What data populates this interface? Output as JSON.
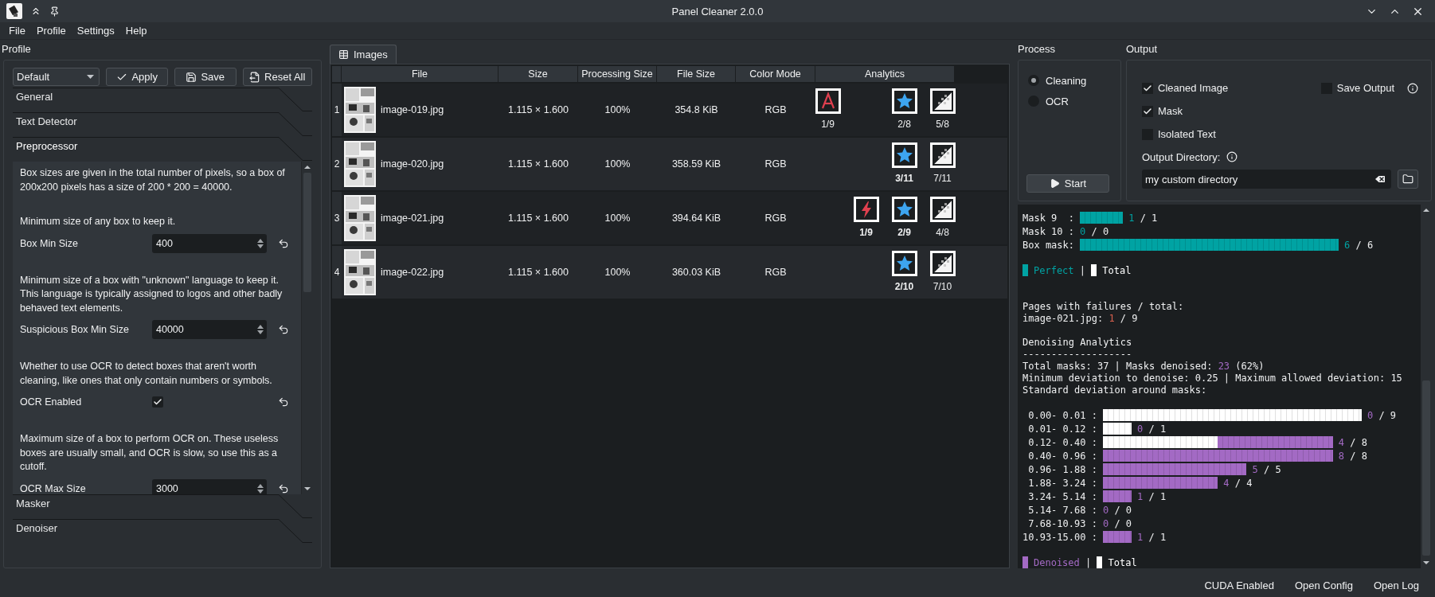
{
  "window": {
    "title": "Panel Cleaner 2.0.0"
  },
  "menu": [
    "File",
    "Profile",
    "Settings",
    "Help"
  ],
  "profile": {
    "label": "Profile",
    "selected_profile": "Default",
    "buttons": [
      {
        "kind": "apply",
        "label": "Apply"
      },
      {
        "kind": "save",
        "label": "Save"
      },
      {
        "kind": "reset",
        "label": "Reset All"
      }
    ],
    "sections": [
      {
        "title": "General",
        "expanded": false
      },
      {
        "title": "Text Detector",
        "expanded": false
      },
      {
        "title": "Preprocessor",
        "expanded": true,
        "settings": [
          {
            "kind": "note",
            "text": "Box sizes are given in the total number of pixels, so a box of 200x200 pixels has a size of 200 * 200 = 40000."
          },
          {
            "kind": "note",
            "text": "Minimum size of any box to keep it."
          },
          {
            "kind": "number",
            "label": "Box Min Size",
            "value": "400"
          },
          {
            "kind": "note",
            "text": "Minimum size of a box with \"unknown\" language to keep it. This language is typically assigned to logos and other badly behaved text elements."
          },
          {
            "kind": "number",
            "label": "Suspicious Box Min Size",
            "value": "40000"
          },
          {
            "kind": "note",
            "text": "Whether to use OCR to detect boxes that aren't worth cleaning, like ones that only contain numbers or symbols."
          },
          {
            "kind": "check",
            "label": "OCR Enabled",
            "checked": true
          },
          {
            "kind": "note",
            "text": "Maximum size of a box to perform OCR on. These useless boxes are usually small, and OCR is slow, so use this as a cutoff."
          },
          {
            "kind": "number",
            "label": "OCR Max Size",
            "value": "3000"
          }
        ]
      },
      {
        "title": "Masker",
        "expanded": false
      },
      {
        "title": "Denoiser",
        "expanded": false
      }
    ]
  },
  "images_tab": {
    "label": "Images",
    "selected": true
  },
  "table": {
    "columns": [
      "File",
      "Size",
      "Processing Size",
      "File Size",
      "Color Mode",
      "Analytics"
    ],
    "rows": [
      {
        "number": "1",
        "file": "image-019.jpg",
        "size": "1.115 × 1.600",
        "processing_size": "100%",
        "file_size": "354.8 KiB",
        "color_mode": "RGB",
        "analytics": [
          {
            "kind": "ocr",
            "reading": "1/9",
            "bold": false
          },
          {
            "kind": "star",
            "reading": "2/8",
            "bold": false
          },
          {
            "kind": "mask",
            "reading": "5/8",
            "bold": false
          }
        ]
      },
      {
        "number": "2",
        "file": "image-020.jpg",
        "size": "1.115 × 1.600",
        "processing_size": "100%",
        "file_size": "358.59 KiB",
        "color_mode": "RGB",
        "analytics": [
          {
            "kind": "star",
            "reading": "3/11",
            "bold": true
          },
          {
            "kind": "mask",
            "reading": "7/11",
            "bold": false
          }
        ]
      },
      {
        "number": "3",
        "file": "image-021.jpg",
        "size": "1.115 × 1.600",
        "processing_size": "100%",
        "file_size": "394.64 KiB",
        "color_mode": "RGB",
        "analytics": [
          {
            "kind": "lightning",
            "reading": "1/9",
            "bold": true
          },
          {
            "kind": "star",
            "reading": "2/9",
            "bold": true
          },
          {
            "kind": "mask",
            "reading": "4/8",
            "bold": false
          }
        ]
      },
      {
        "number": "4",
        "file": "image-022.jpg",
        "size": "1.115 × 1.600",
        "processing_size": "100%",
        "file_size": "360.03 KiB",
        "color_mode": "RGB",
        "analytics": [
          {
            "kind": "star",
            "reading": "2/10",
            "bold": true
          },
          {
            "kind": "mask",
            "reading": "7/10",
            "bold": false
          }
        ]
      }
    ]
  },
  "process": {
    "label": "Process",
    "modes": [
      {
        "label": "Cleaning",
        "selected": true
      },
      {
        "label": "OCR",
        "selected": false
      }
    ],
    "start_button": "Start"
  },
  "output": {
    "label": "Output",
    "options": [
      {
        "label": "Cleaned Image",
        "checked": true
      },
      {
        "label": "Mask",
        "checked": true
      },
      {
        "label": "Isolated Text",
        "checked": false
      }
    ],
    "save_output": {
      "label": "Save Output",
      "checked": false
    },
    "directory_label": "Output Directory:",
    "directory_value": "my custom directory"
  },
  "log": [
    {
      "kind": "bar",
      "label": "Mask 9  :",
      "count": "1",
      "total": "/ 1",
      "color": "#00a3a3"
    },
    {
      "kind": "bar",
      "label": "Mask 10 :",
      "count": "0",
      "total": "/ 0",
      "color": "#00a3a3"
    },
    {
      "kind": "bar",
      "label": "Box mask:",
      "count": "6",
      "total": "/ 6",
      "color": "#00a3a3"
    },
    {
      "kind": "gap"
    },
    {
      "kind": "legend",
      "separator": "|",
      "items": [
        {
          "text": "Perfect",
          "color": "#00a3a3"
        },
        {
          "text": "Total",
          "color": "#ffffff"
        }
      ]
    },
    {
      "kind": "gap"
    },
    {
      "kind": "gap"
    },
    {
      "kind": "text",
      "parts": [
        {
          "text": "Pages with failures / total:"
        }
      ]
    },
    {
      "kind": "text",
      "parts": [
        {
          "text": "image-021.jpg: "
        },
        {
          "text": "1",
          "color": "#d9614e"
        },
        {
          "text": " / 9"
        }
      ]
    },
    {
      "kind": "gap"
    },
    {
      "kind": "text",
      "parts": [
        {
          "text": "Denoising Analytics"
        }
      ]
    },
    {
      "kind": "text",
      "parts": [
        {
          "text": "-------------------"
        }
      ]
    },
    {
      "kind": "text",
      "parts": [
        {
          "text": "Total masks: 37 | Masks denoised: "
        },
        {
          "text": "23",
          "color": "#a36ac4"
        },
        {
          "text": " (62%)"
        }
      ]
    },
    {
      "kind": "text",
      "parts": [
        {
          "text": "Minimum deviation to denoise: 0.25 | Maximum allowed deviation: 15"
        }
      ]
    },
    {
      "kind": "text",
      "parts": [
        {
          "text": "Standard deviation around masks:"
        }
      ]
    },
    {
      "kind": "gap"
    },
    {
      "kind": "bar",
      "label": " 0.00- 0.01 :",
      "count": "0",
      "total": "/ 9",
      "color": "#a36ac4"
    },
    {
      "kind": "bar",
      "label": " 0.01- 0.12 :",
      "count": "0",
      "total": "/ 1",
      "color": "#a36ac4"
    },
    {
      "kind": "bar",
      "label": " 0.12- 0.40 :",
      "count": "4",
      "total": "/ 8",
      "color": "#a36ac4"
    },
    {
      "kind": "bar",
      "label": " 0.40- 0.96 :",
      "count": "8",
      "total": "/ 8",
      "color": "#a36ac4"
    },
    {
      "kind": "bar",
      "label": " 0.96- 1.88 :",
      "count": "5",
      "total": "/ 5",
      "color": "#a36ac4"
    },
    {
      "kind": "bar",
      "label": " 1.88- 3.24 :",
      "count": "4",
      "total": "/ 4",
      "color": "#a36ac4"
    },
    {
      "kind": "bar",
      "label": " 3.24- 5.14 :",
      "count": "1",
      "total": "/ 1",
      "color": "#a36ac4"
    },
    {
      "kind": "bar",
      "label": " 5.14- 7.68 :",
      "count": "0",
      "total": "/ 0",
      "color": "#a36ac4"
    },
    {
      "kind": "bar",
      "label": " 7.68-10.93 :",
      "count": "0",
      "total": "/ 0",
      "color": "#a36ac4"
    },
    {
      "kind": "bar",
      "label": "10.93-15.00 :",
      "count": "1",
      "total": "/ 1",
      "color": "#a36ac4"
    },
    {
      "kind": "gap"
    },
    {
      "kind": "legend",
      "separator": "|",
      "items": [
        {
          "text": "Denoised",
          "color": "#a36ac4"
        },
        {
          "text": "Total",
          "color": "#ffffff"
        }
      ]
    }
  ],
  "status_bar": [
    "CUDA Enabled",
    "Open Config",
    "Open Log"
  ]
}
